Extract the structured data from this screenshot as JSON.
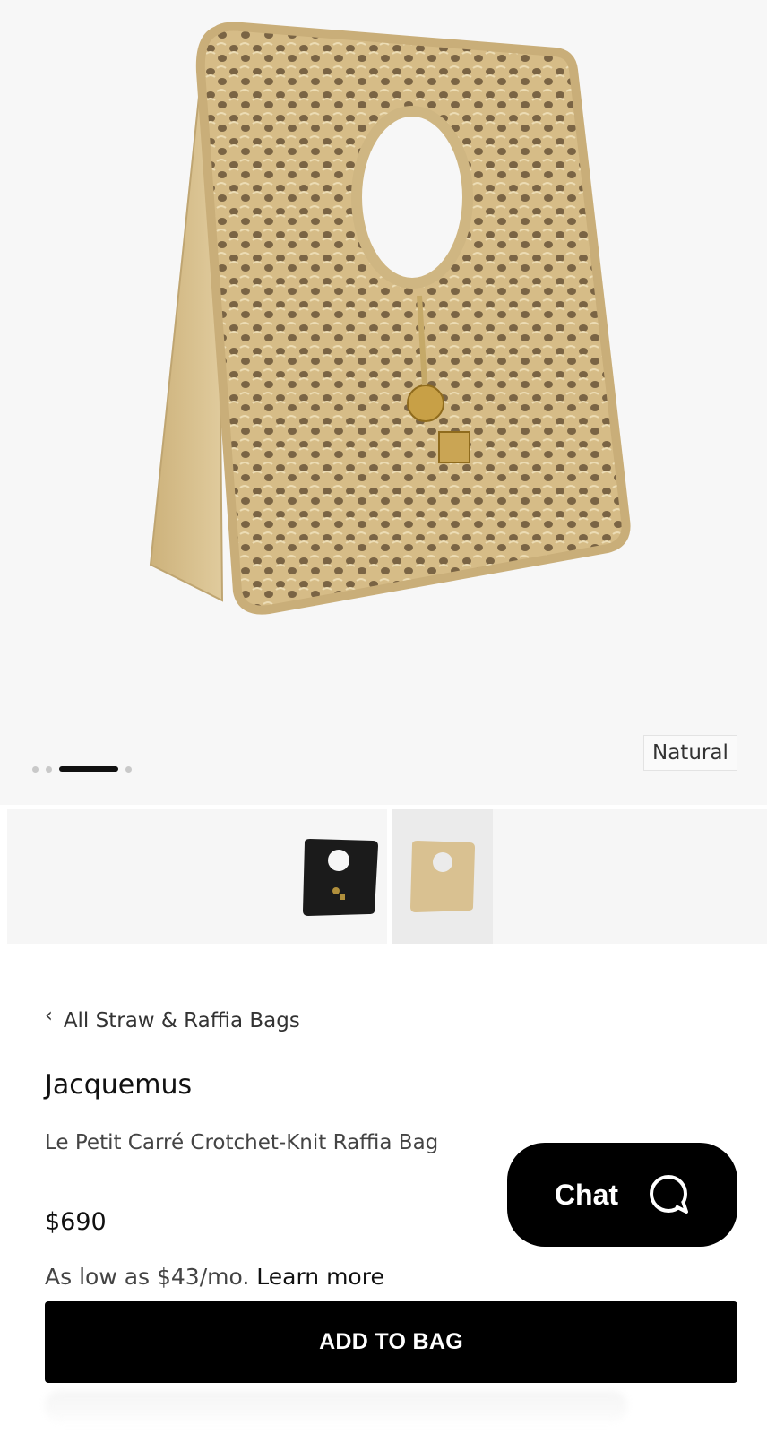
{
  "hero": {
    "image_alt": "Jacquemus Le Petit Carré Crotchet-Knit Raffia Bag in natural",
    "color_tag": "Natural",
    "carousel": {
      "count": 4,
      "active_index": 2
    }
  },
  "swatches": [
    {
      "name": "Black",
      "color": "#1b1b1b",
      "selected": false
    },
    {
      "name": "Natural",
      "color": "#d8c08c",
      "selected": true
    }
  ],
  "breadcrumb": {
    "label": "All Straw & Raffia Bags",
    "icon": "chevron-left-icon"
  },
  "product": {
    "brand": "Jacquemus",
    "name": "Le Petit Carré Crotchet-Knit Raffia Bag",
    "price": "$690"
  },
  "financing": {
    "text": "As low as $43/mo.",
    "link": "Learn more"
  },
  "chat": {
    "label": "Chat",
    "icon": "chat-bubble-icon"
  },
  "cta": {
    "add_to_bag": "ADD TO BAG"
  },
  "colors": {
    "raffia": "#d9c191",
    "raffia_dark": "#b79d68",
    "hero_bg": "#f7f7f7",
    "button": "#000000"
  }
}
